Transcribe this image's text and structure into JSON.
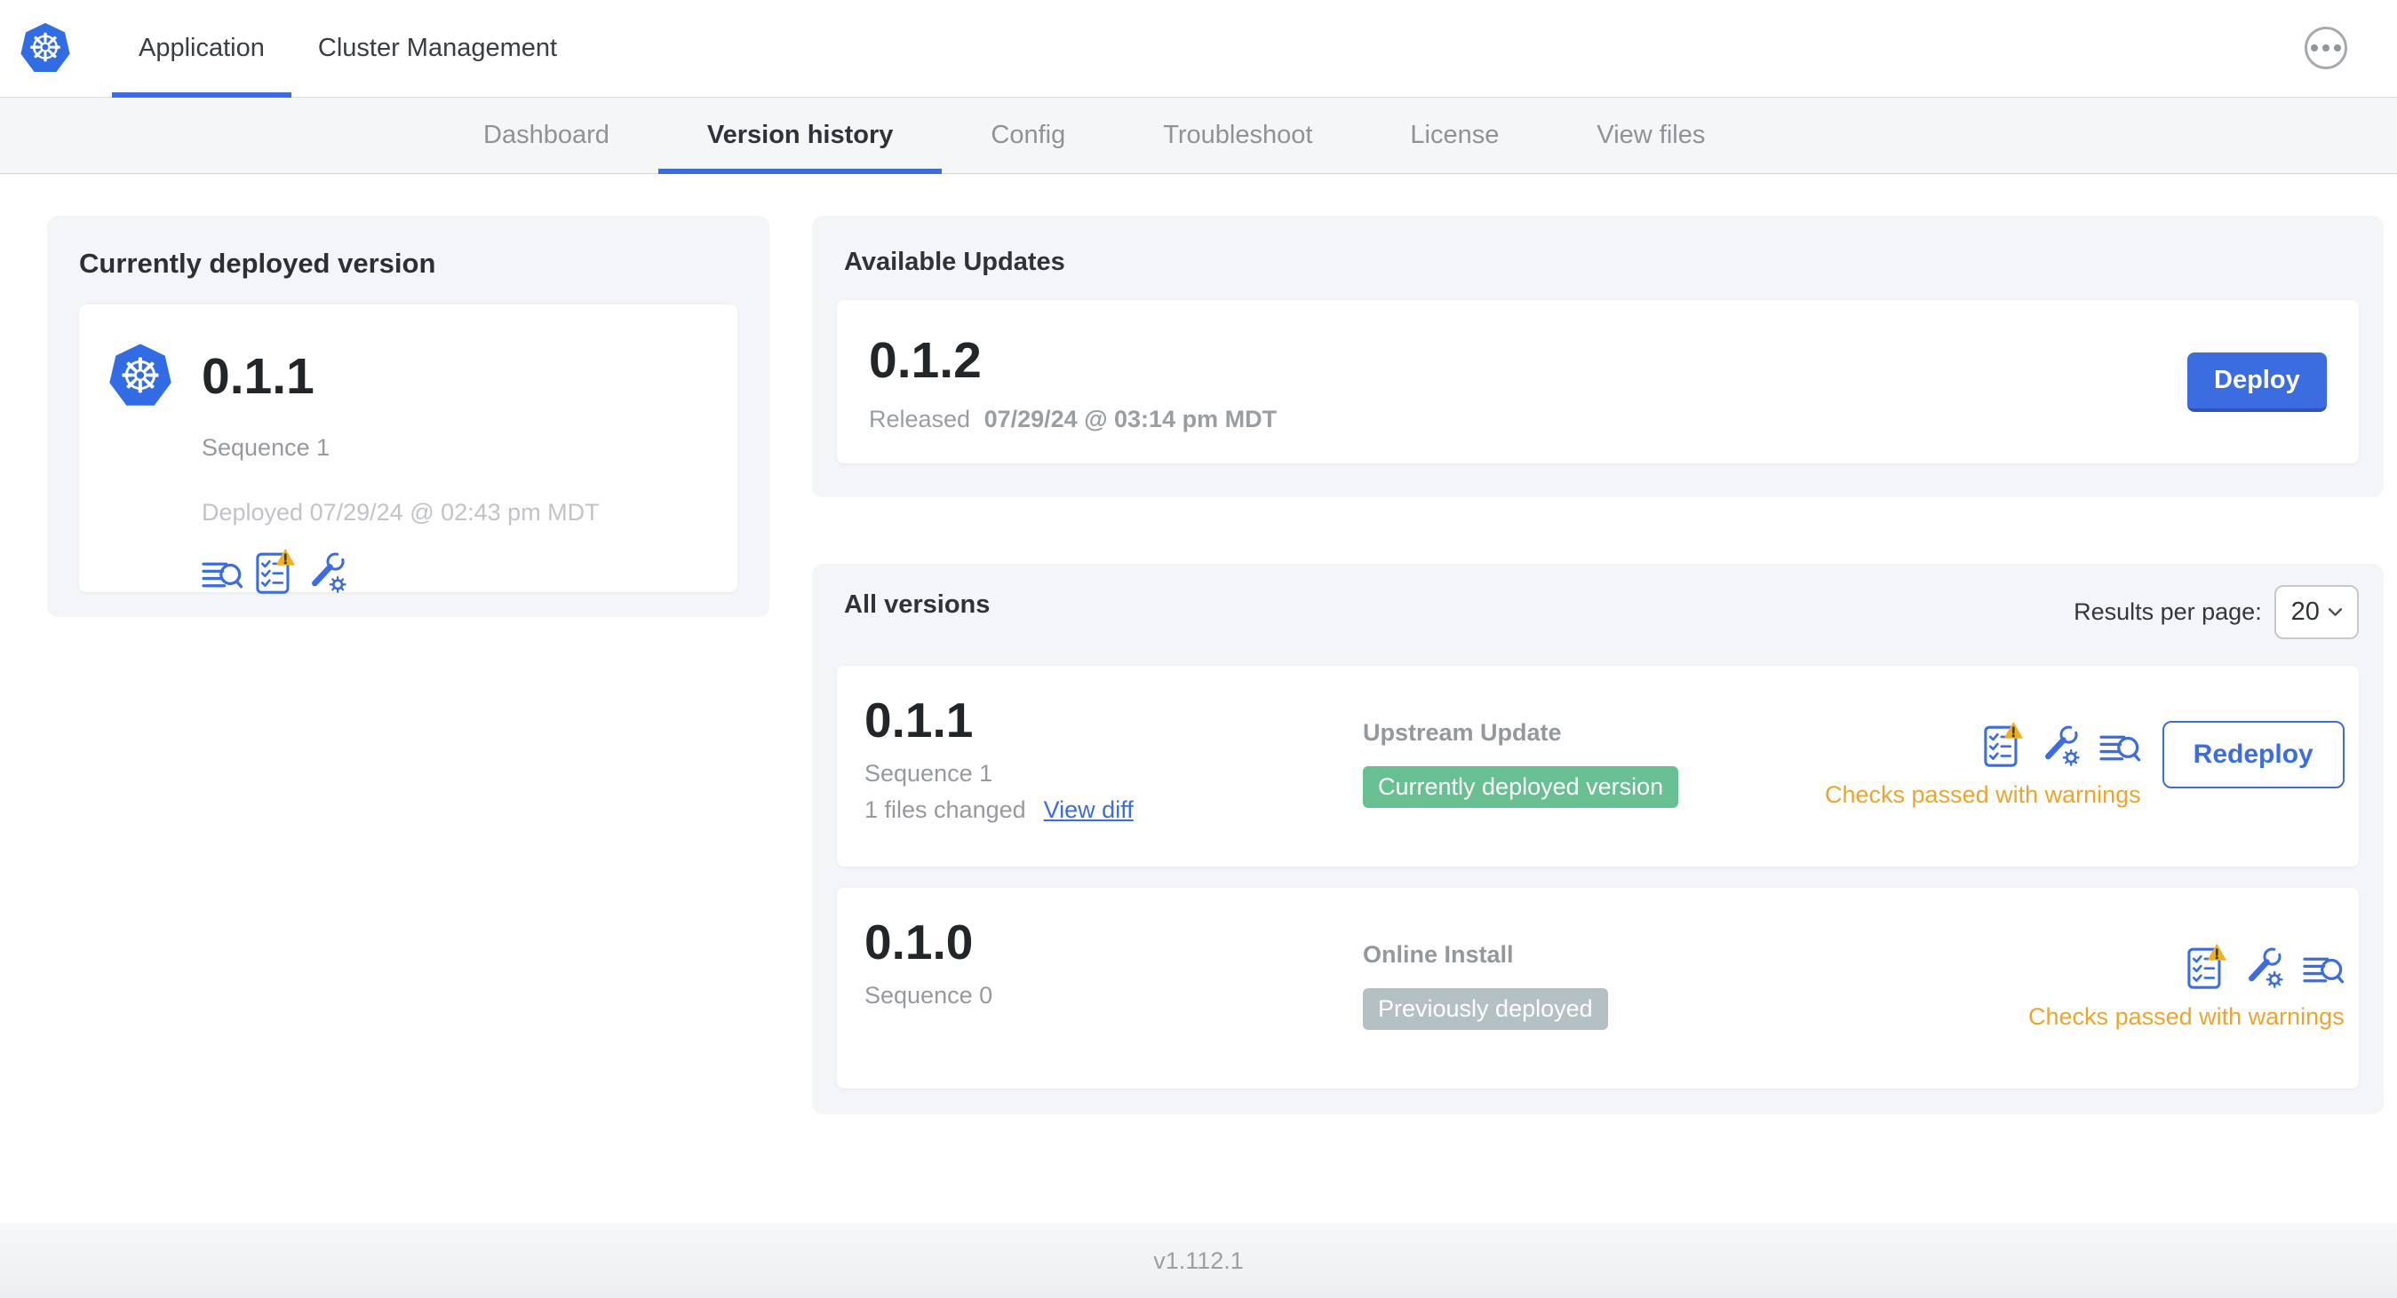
{
  "colors": {
    "accent_blue": "#3b6ce0",
    "kubernetes_blue": "#326ce5",
    "badge_green": "#68c092",
    "badge_gray": "#b4c0c3",
    "warning_orange": "#eda42f",
    "warning_triangle": "#f2b01e"
  },
  "top_nav": {
    "tabs": [
      {
        "label": "Application",
        "active": true
      },
      {
        "label": "Cluster Management",
        "active": false
      }
    ]
  },
  "sub_nav": {
    "active": "Version history",
    "tabs": [
      {
        "label": "Dashboard"
      },
      {
        "label": "Version history"
      },
      {
        "label": "Config"
      },
      {
        "label": "Troubleshoot"
      },
      {
        "label": "License"
      },
      {
        "label": "View files"
      }
    ]
  },
  "current_version": {
    "title": "Currently deployed version",
    "version": "0.1.1",
    "sequence": "Sequence 1",
    "deployed_label": "Deployed",
    "deployed_at": "07/29/24 @ 02:43 pm MDT"
  },
  "available_updates": {
    "title": "Available Updates",
    "version": "0.1.2",
    "released_label": "Released",
    "released_at": "07/29/24 @ 03:14 pm MDT",
    "deploy_button": "Deploy"
  },
  "all_versions": {
    "title": "All versions",
    "results_per_page_label": "Results per page:",
    "results_per_page": "20",
    "rows": [
      {
        "version": "0.1.1",
        "sequence": "Sequence 1",
        "files_changed": "1 files changed",
        "view_diff_link": "View diff",
        "source": "Upstream Update",
        "status_badge": "Currently deployed version",
        "checks_status": "Checks passed with warnings",
        "redeploy_button": "Redeploy"
      },
      {
        "version": "0.1.0",
        "sequence": "Sequence 0",
        "source": "Online Install",
        "status_badge": "Previously deployed",
        "checks_status": "Checks passed with warnings"
      }
    ]
  },
  "footer": {
    "app_version": "v1.112.1"
  }
}
